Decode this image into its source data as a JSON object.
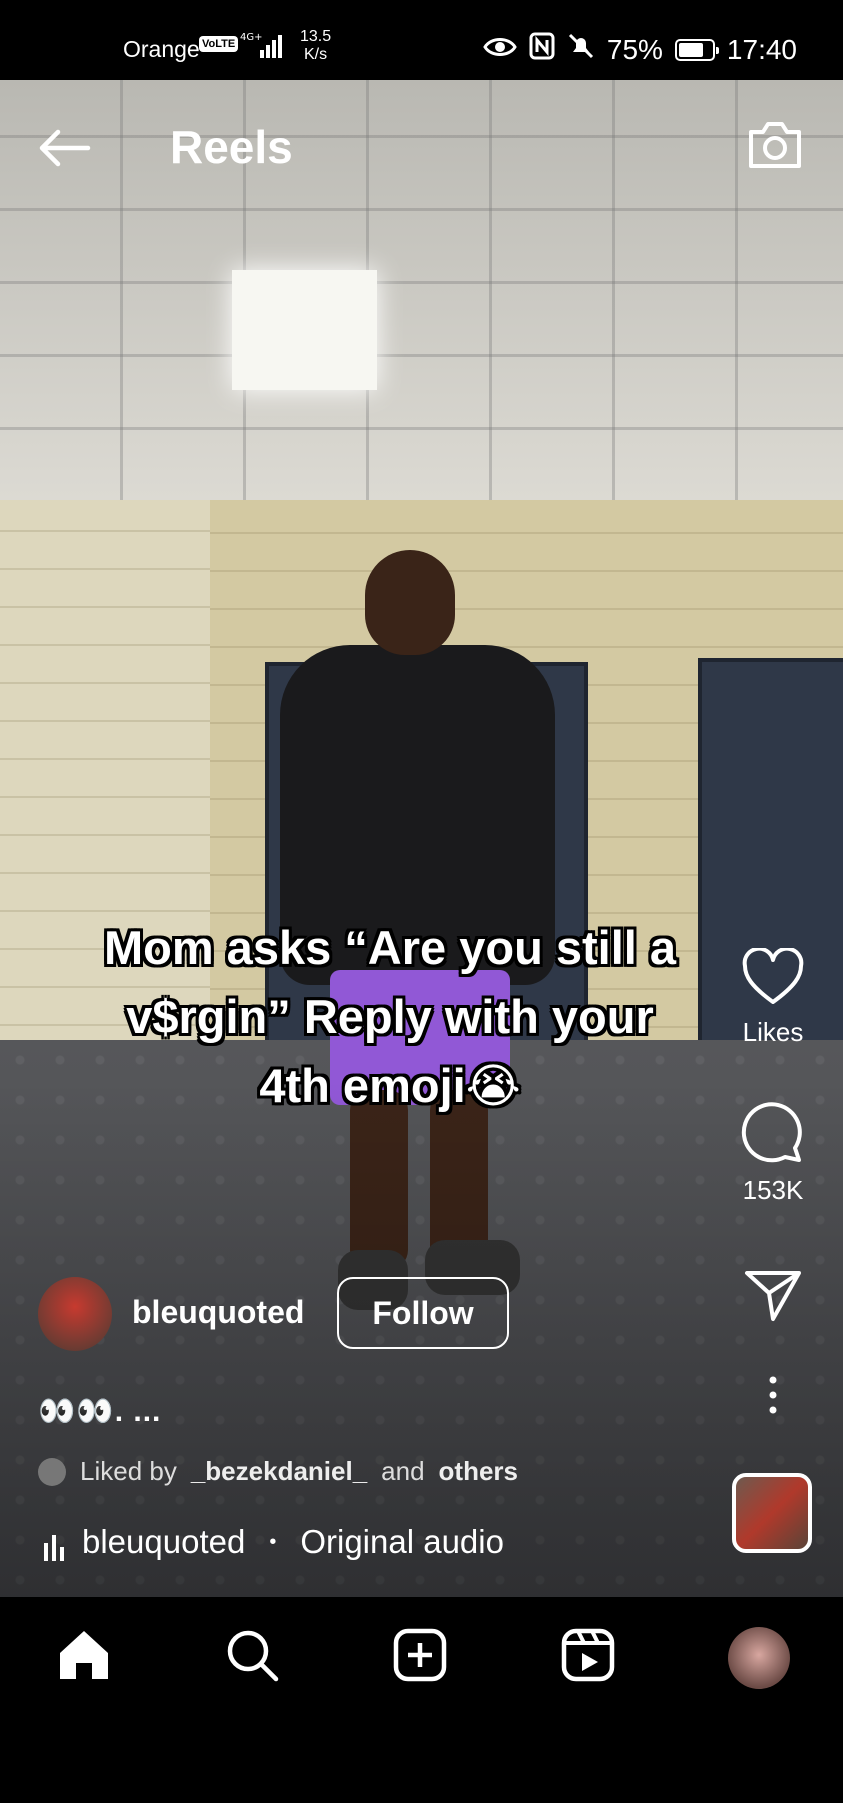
{
  "status_bar": {
    "carrier": "Orange",
    "volte": "VoLTE",
    "network": "4G+",
    "speed_value": "13.5",
    "speed_unit": "K/s",
    "battery": "75%",
    "time": "17:40",
    "battery_level": 0.75,
    "icons": [
      "eye-icon",
      "nfc-icon",
      "mute-icon",
      "battery-icon"
    ]
  },
  "header": {
    "title": "Reels",
    "back_icon": "back-arrow-icon",
    "camera_icon": "camera-icon"
  },
  "reel": {
    "caption_lines": [
      "Mom asks “Are you still a",
      "v$rgin” Reply with your",
      "4th emoji😭"
    ],
    "actions": {
      "likes_label": "Likes",
      "comments_count": "153K"
    },
    "author": {
      "username": "bleuquoted",
      "follow_label": "Follow"
    },
    "description": "👀👀. ...",
    "liked_by_prefix": "Liked by",
    "liked_by_user": "_bezekdaniel_",
    "liked_by_and": "and",
    "liked_by_others": "others",
    "audio_artist": "bleuquoted",
    "audio_sep": "•",
    "audio_title": "Original audio"
  },
  "bottom_nav": {
    "items": [
      "home-icon",
      "search-icon",
      "create-icon",
      "reels-icon",
      "profile-avatar"
    ]
  }
}
